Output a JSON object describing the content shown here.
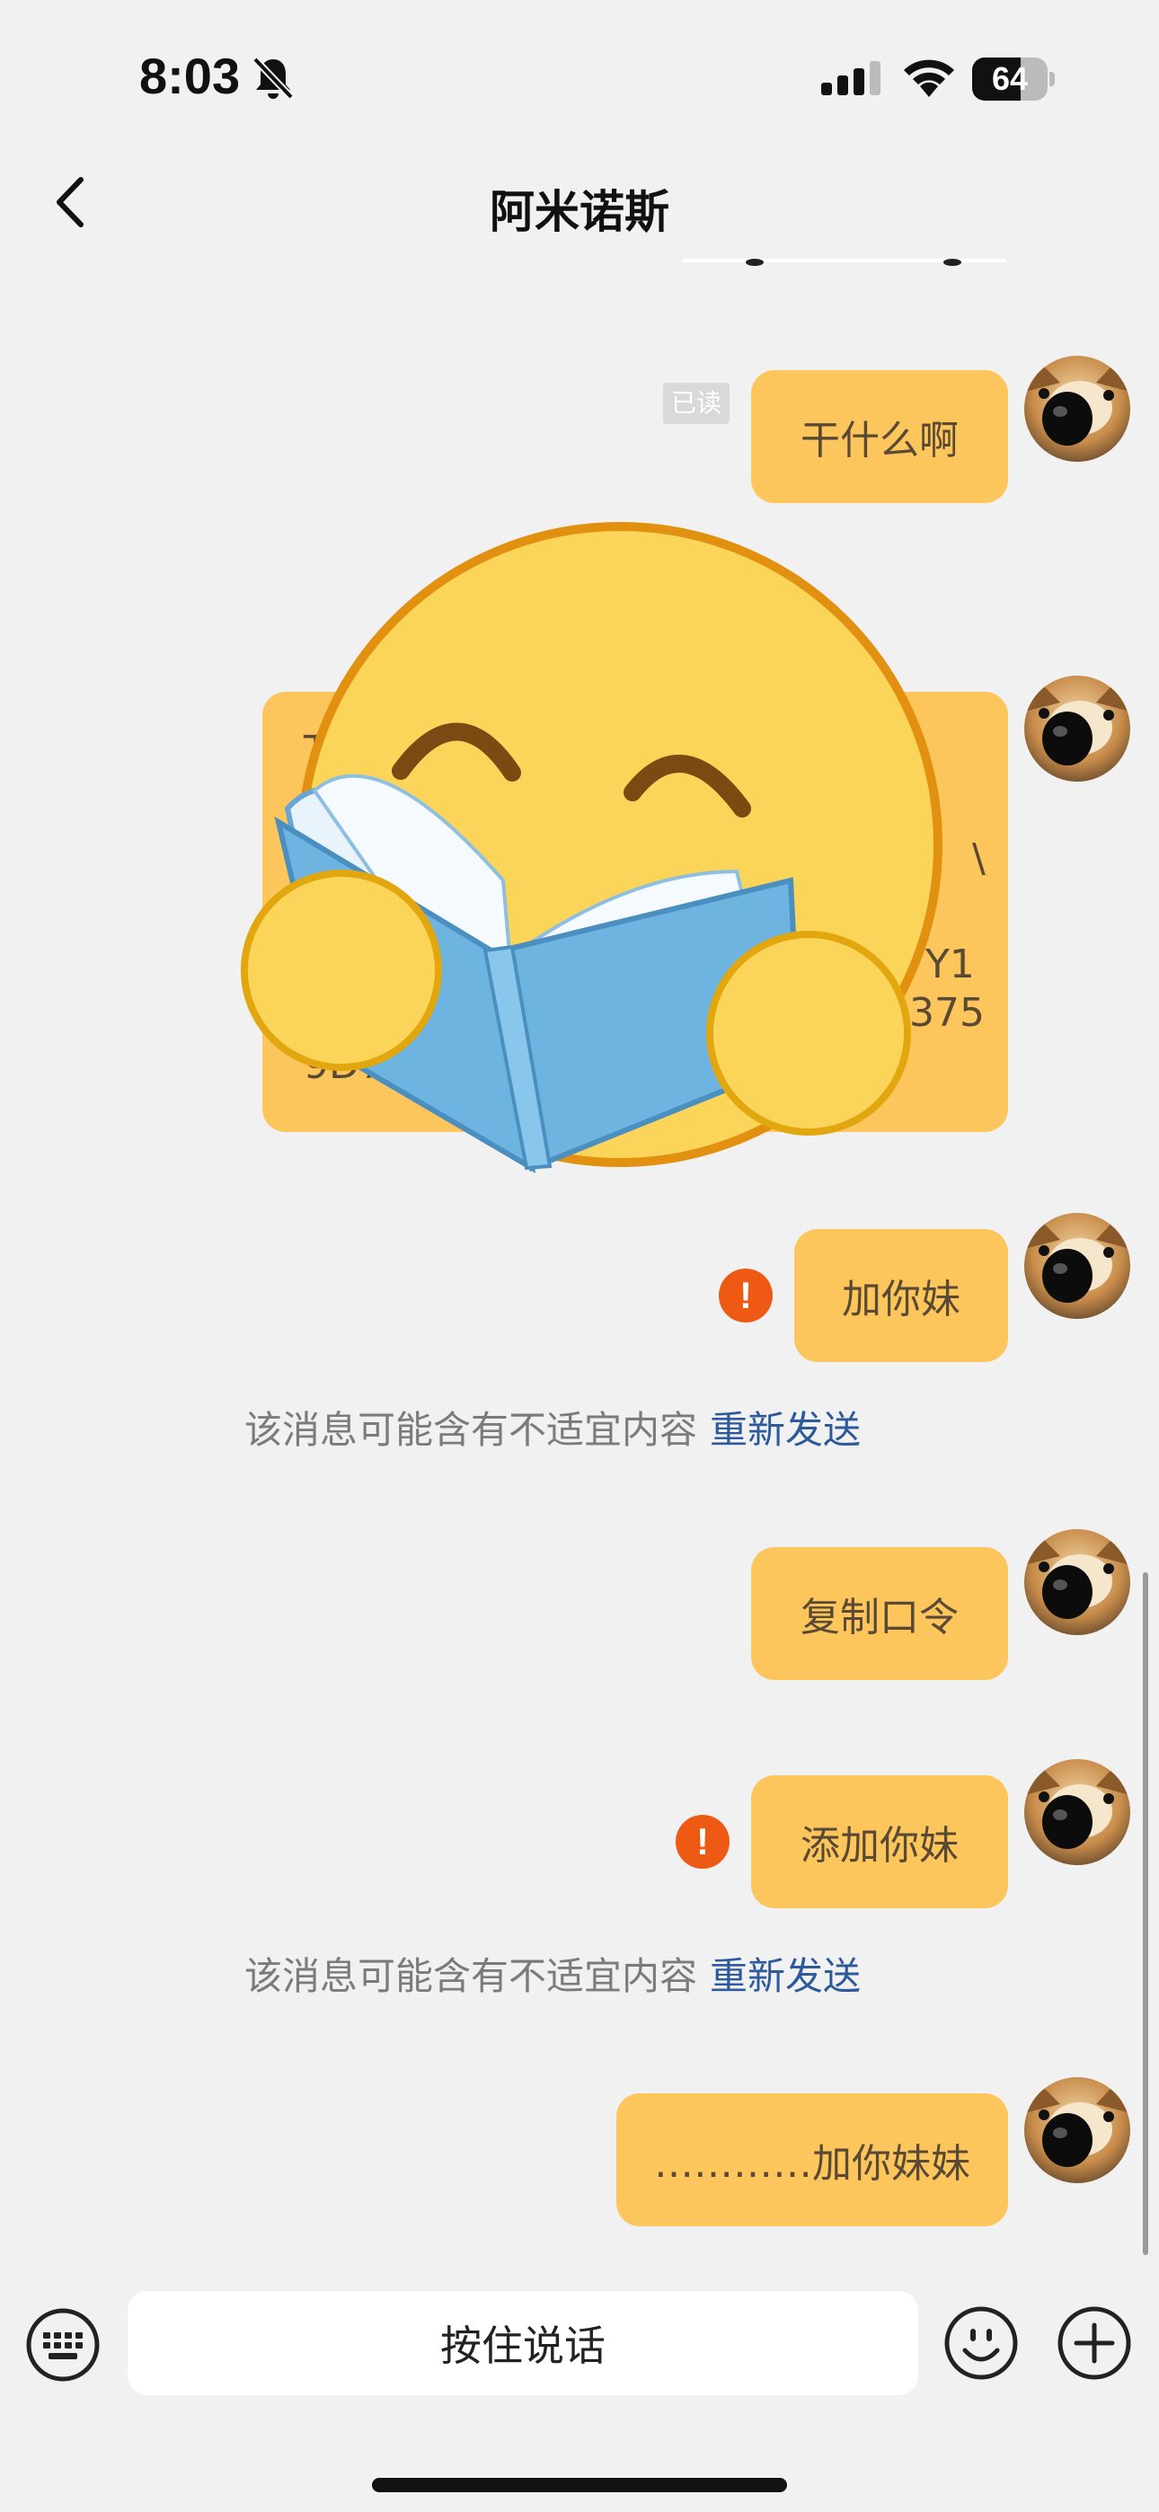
{
  "status_bar": {
    "time": "8:03",
    "battery": "64",
    "battery_level_percent": 64
  },
  "header": {
    "title": "阿米诺斯"
  },
  "messages": [
    {
      "text": "干什么啊",
      "read_label": "已读"
    },
    {
      "card_fragments": [
        "T",
        "\\",
        "Y1",
        "375",
        "9D7D"
      ]
    },
    {
      "text": "加你妹",
      "error_icon": "!"
    },
    {
      "warning": "该消息可能含有不适宜内容",
      "resend": "重新发送"
    },
    {
      "text": "复制口令"
    },
    {
      "text": "添加你妹",
      "error_icon": "!"
    },
    {
      "warning": "该消息可能含有不适宜内容",
      "resend": "重新发送"
    },
    {
      "text": "…………加你妹妹"
    }
  ],
  "input_bar": {
    "hold_to_talk": "按住说话"
  },
  "colors": {
    "bubble": "#fdc65c",
    "bubble_text": "#5a4a34",
    "error": "#ee5a14",
    "link": "#2c5a9a",
    "background": "#f1f1f1"
  },
  "icons": [
    "back-arrow-icon",
    "bell-off-icon",
    "signal-icon",
    "wifi-icon",
    "battery-icon",
    "keyboard-icon",
    "emoji-icon",
    "plus-icon",
    "error-icon"
  ]
}
